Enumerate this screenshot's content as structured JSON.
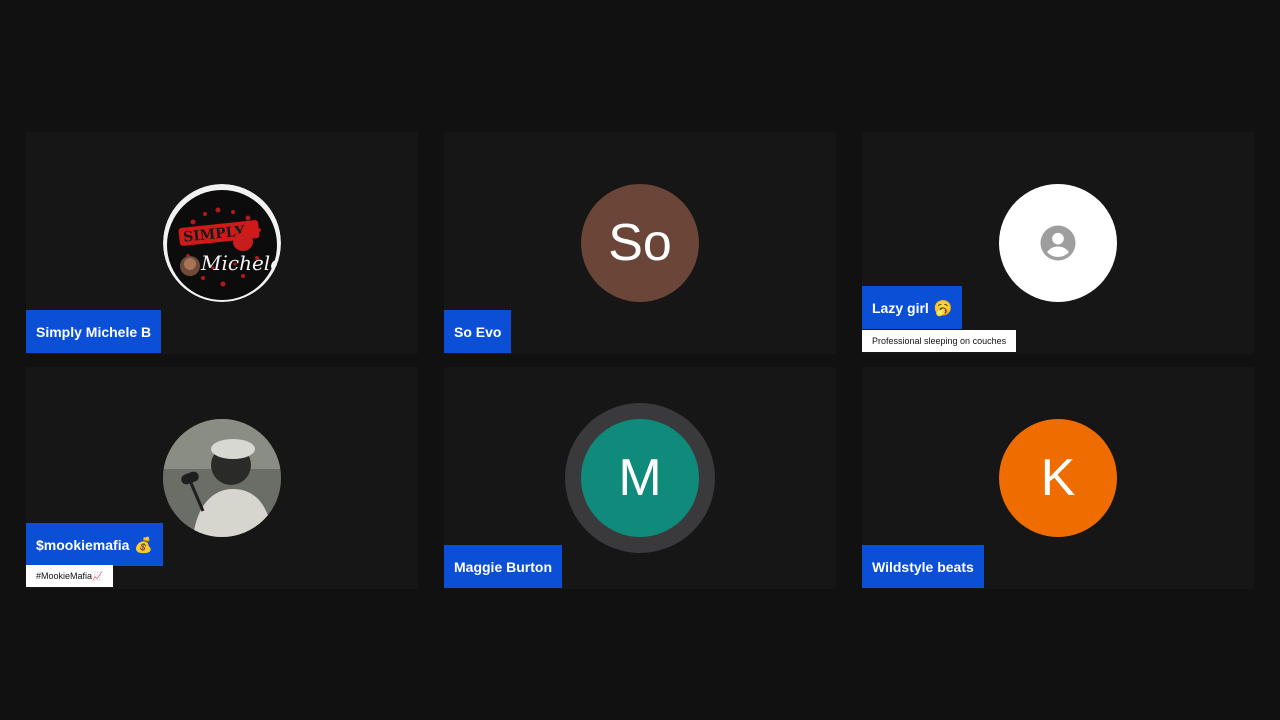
{
  "participants": [
    {
      "name": "Simply Michele B",
      "avatar_type": "image",
      "avatar_icon": "simply-michele-logo-image"
    },
    {
      "name": "So Evo",
      "avatar_type": "initials",
      "initials": "So",
      "avatar_color": "#6b4537"
    },
    {
      "name": "Lazy girl",
      "name_emoji": "🥱",
      "status": "Professional sleeping on couches",
      "avatar_type": "placeholder",
      "avatar_icon": "account-circle-icon",
      "avatar_color": "#ffffff"
    },
    {
      "name": "$mookiemafia",
      "name_emoji": "💰",
      "status": "#MookieMafia📈",
      "avatar_type": "image",
      "avatar_icon": "user-photo-grayscale"
    },
    {
      "name": "Maggie Burton",
      "avatar_type": "initials",
      "initials": "M",
      "avatar_color": "#0f8a7b",
      "speaking": true
    },
    {
      "name": "Wildstyle beats",
      "avatar_type": "initials",
      "initials": "K",
      "avatar_color": "#ef6c00"
    }
  ],
  "colors": {
    "name_tag_bg": "#0b4fd6",
    "tile_bg": "#161617",
    "page_bg": "#111112"
  }
}
